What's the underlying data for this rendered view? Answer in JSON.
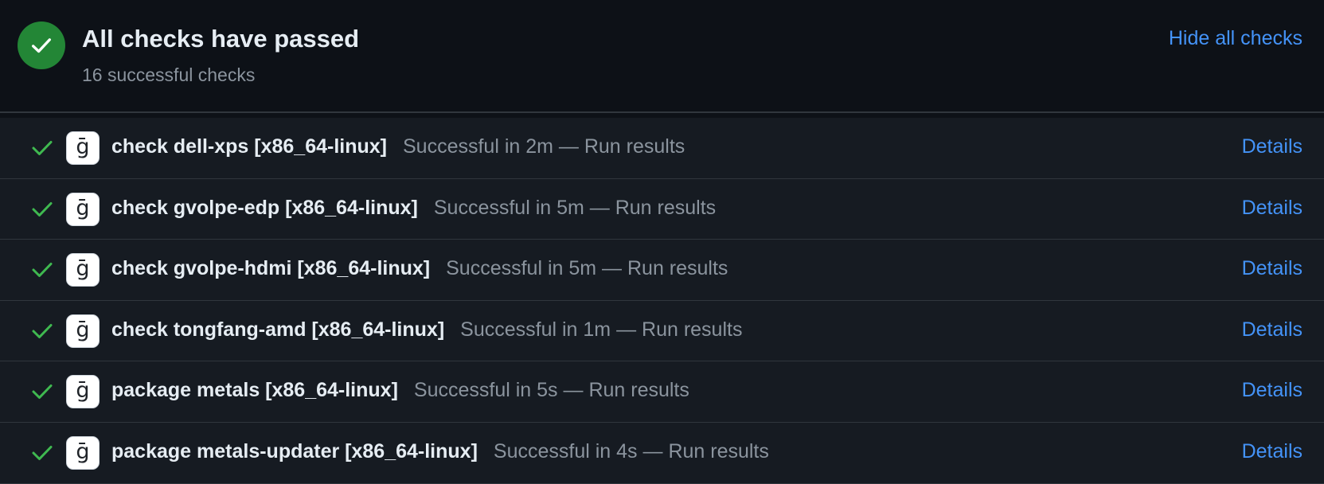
{
  "header": {
    "title": "All checks have passed",
    "subtitle": "16 successful checks",
    "hide_link": "Hide all checks",
    "status_icon": "check-circle-icon",
    "status_color": "#238636"
  },
  "colors": {
    "background": "#161b22",
    "header_background": "#0d1117",
    "link": "#4493f8",
    "success_check": "#3fb950",
    "muted_text": "#8b949e"
  },
  "checks": [
    {
      "name": "check dell-xps [x86_64-linux]",
      "description": "Successful in 2m — Run results",
      "app_icon_text": "ḡ",
      "details_label": "Details"
    },
    {
      "name": "check gvolpe-edp [x86_64-linux]",
      "description": "Successful in 5m — Run results",
      "app_icon_text": "ḡ",
      "details_label": "Details"
    },
    {
      "name": "check gvolpe-hdmi [x86_64-linux]",
      "description": "Successful in 5m — Run results",
      "app_icon_text": "ḡ",
      "details_label": "Details"
    },
    {
      "name": "check tongfang-amd [x86_64-linux]",
      "description": "Successful in 1m — Run results",
      "app_icon_text": "ḡ",
      "details_label": "Details"
    },
    {
      "name": "package metals [x86_64-linux]",
      "description": "Successful in 5s — Run results",
      "app_icon_text": "ḡ",
      "details_label": "Details"
    },
    {
      "name": "package metals-updater [x86_64-linux]",
      "description": "Successful in 4s — Run results",
      "app_icon_text": "ḡ",
      "details_label": "Details"
    }
  ]
}
